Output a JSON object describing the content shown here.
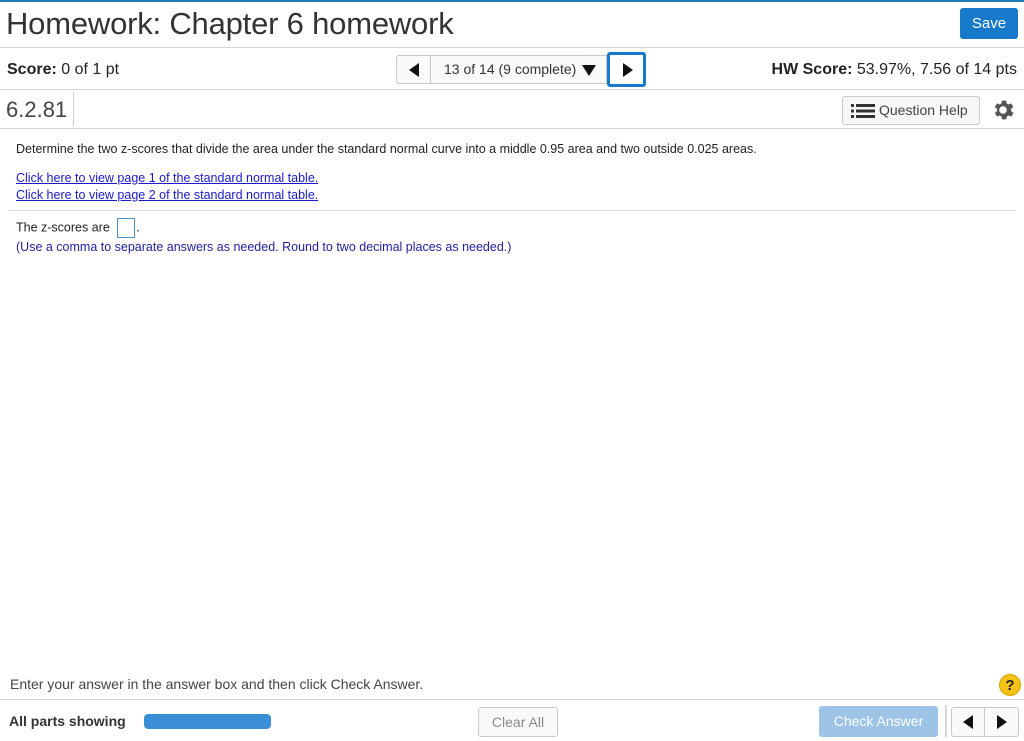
{
  "header": {
    "title": "Homework: Chapter 6 homework",
    "save_label": "Save"
  },
  "score_row": {
    "score_label": "Score:",
    "score_value": "0 of 1 pt",
    "nav_position": "13 of 14 (9 complete)",
    "hw_score_label": "HW Score:",
    "hw_score_value": "53.97%, 7.56 of 14 pts"
  },
  "question": {
    "number": "6.2.81",
    "help_label": "Question Help",
    "prompt": "Determine the two z-scores that divide the area under the standard normal curve into a middle 0.95 area and two outside 0.025 areas.",
    "link1": "Click here to view page 1 of the standard normal table.",
    "link2": "Click here to view page 2 of the standard normal table.",
    "answer_prefix": "The z-scores are",
    "answer_suffix": ".",
    "answer_value": "",
    "hint": "(Use a comma to separate answers as needed. Round to two decimal places as needed.)"
  },
  "instruction": "Enter your answer in the answer box and then click Check Answer.",
  "help_glyph": "?",
  "footer": {
    "parts_label": "All parts showing",
    "progress_fraction": 1.0,
    "clear_label": "Clear All",
    "check_label": "Check Answer"
  },
  "colors": {
    "accent": "#1779c9",
    "link": "#1a1acc",
    "hint": "#1f1f9c",
    "check_disabled": "#9dc3e6",
    "help_badge": "#f5c318"
  },
  "icons": [
    "chevron-left-icon",
    "chevron-right-icon",
    "caret-down-icon",
    "list-icon",
    "gear-icon",
    "help-icon"
  ]
}
